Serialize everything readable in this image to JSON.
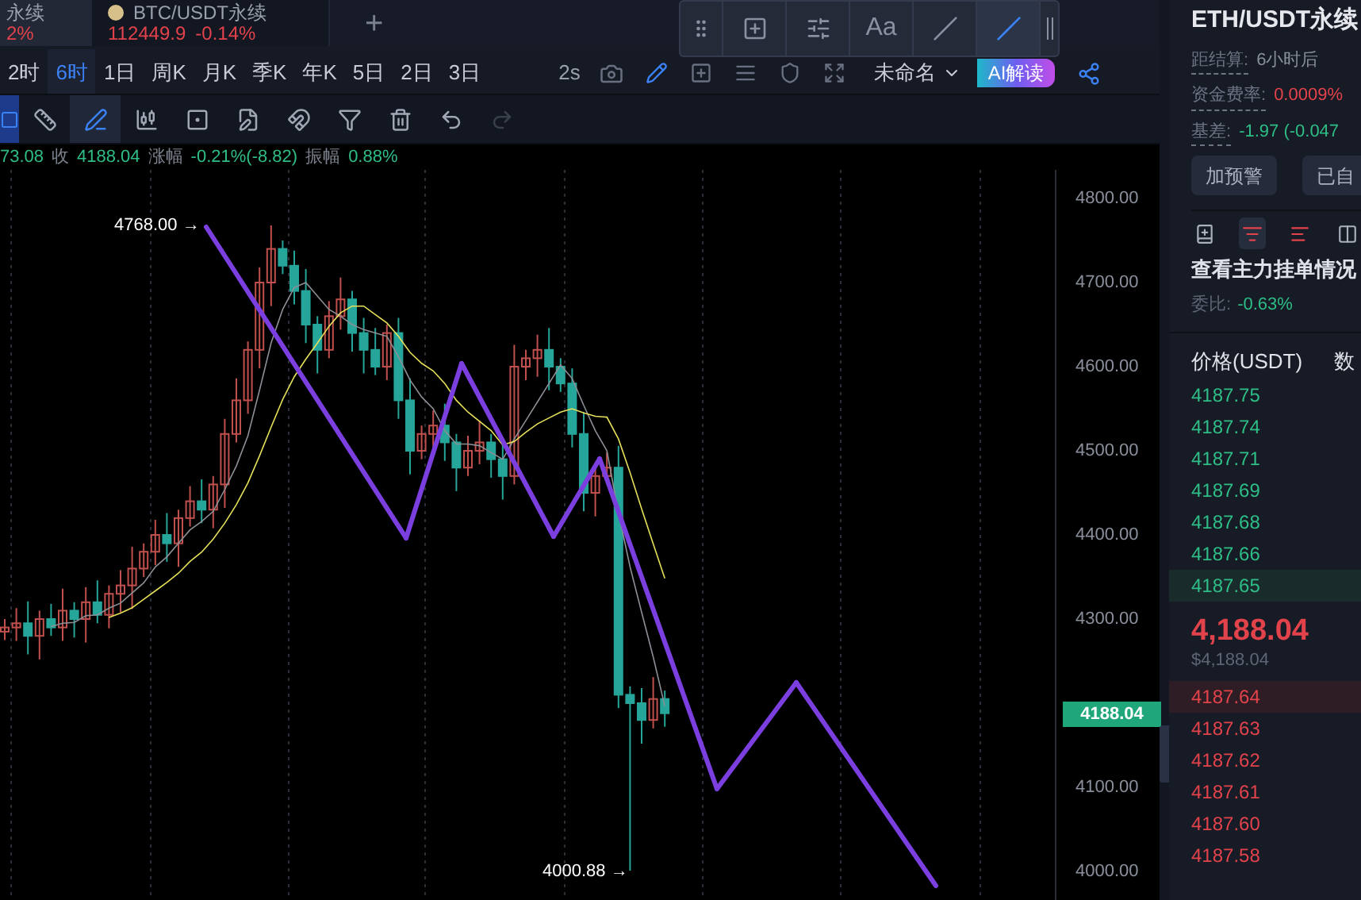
{
  "tabs": [
    {
      "symbol": "永续",
      "change": "2%",
      "selected": true
    },
    {
      "symbol": "BTC/USDT永续",
      "price": "112449.9",
      "change": "-0.14%",
      "selected": false
    }
  ],
  "add_tab": "+",
  "intervals": [
    {
      "label": "2时",
      "selected": false
    },
    {
      "label": "6时",
      "selected": true
    },
    {
      "label": "1日",
      "selected": false
    },
    {
      "label": "周K",
      "selected": false
    },
    {
      "label": "月K",
      "selected": false
    },
    {
      "label": "季K",
      "selected": false
    },
    {
      "label": "年K",
      "selected": false
    },
    {
      "label": "5日",
      "selected": false
    },
    {
      "label": "2日",
      "selected": false
    },
    {
      "label": "3日",
      "selected": false
    }
  ],
  "refresh": "2s",
  "layout_name": "未命名",
  "ai_button": "AI解读",
  "floating_toolbar": [
    {
      "kind": "icon",
      "selected": false
    },
    {
      "kind": "icon",
      "selected": false
    },
    {
      "kind": "text",
      "label": "Aa",
      "selected": false
    },
    {
      "kind": "icon",
      "selected": false
    },
    {
      "kind": "icon",
      "selected": true
    }
  ],
  "drawing_tools": [
    {
      "selected": true,
      "disabled": false
    },
    {
      "selected": false,
      "disabled": false
    },
    {
      "selected": true,
      "disabled": false
    },
    {
      "selected": false,
      "disabled": false
    },
    {
      "selected": false,
      "disabled": false
    },
    {
      "selected": false,
      "disabled": false
    },
    {
      "selected": false,
      "disabled": false
    },
    {
      "selected": false,
      "disabled": false
    },
    {
      "selected": false,
      "disabled": false
    },
    {
      "selected": false,
      "disabled": false
    },
    {
      "selected": false,
      "disabled": true
    }
  ],
  "stats": [
    {
      "value": "73.08"
    },
    {
      "label": "收",
      "value": "4188.04"
    },
    {
      "label": "涨幅",
      "value": "-0.21%(-8.82)"
    },
    {
      "label": "振幅",
      "value": "0.88%"
    }
  ],
  "chart": {
    "price_axis": [
      "4800.00",
      "4700.00",
      "4600.00",
      "4500.00",
      "4400.00",
      "4300.00",
      "4100.00",
      "4000.00"
    ],
    "current_price": "4188.04",
    "high_label": "4768.00 →",
    "low_label": "4000.88 →"
  },
  "panel": {
    "title": "ETH/USDT永续",
    "info": [
      {
        "label": "距结算:",
        "value": "6小时后",
        "color": "#8a8f9c"
      },
      {
        "label": "资金费率:",
        "value": "0.0009%",
        "color": "#e2434b"
      },
      {
        "label": "基差:",
        "value": "-1.97 (-0.047",
        "color": "#2ebd85"
      }
    ],
    "buttons": [
      "加预警",
      "已自"
    ],
    "views": [
      {
        "selected": false
      },
      {
        "selected": true
      },
      {
        "selected": false
      },
      {
        "selected": false
      }
    ],
    "heading": "查看主力挂单情况",
    "ratio": {
      "label": "委比:",
      "value": "-0.63%"
    },
    "columns": [
      "价格(USDT)",
      "数"
    ],
    "asks": [
      {
        "price": "4187.75",
        "highlighted": false
      },
      {
        "price": "4187.74",
        "highlighted": false
      },
      {
        "price": "4187.71",
        "highlighted": false
      },
      {
        "price": "4187.69",
        "highlighted": false
      },
      {
        "price": "4187.68",
        "highlighted": false
      },
      {
        "price": "4187.66",
        "highlighted": false
      },
      {
        "price": "4187.65",
        "highlighted": true
      }
    ],
    "last_price": "4,188.04",
    "last_price_usd": "$4,188.04",
    "bids": [
      {
        "price": "4187.64",
        "highlighted": true
      },
      {
        "price": "4187.63",
        "highlighted": false
      },
      {
        "price": "4187.62",
        "highlighted": false
      },
      {
        "price": "4187.61",
        "highlighted": false
      },
      {
        "price": "4187.60",
        "highlighted": false
      },
      {
        "price": "4187.58",
        "highlighted": false
      }
    ]
  }
}
